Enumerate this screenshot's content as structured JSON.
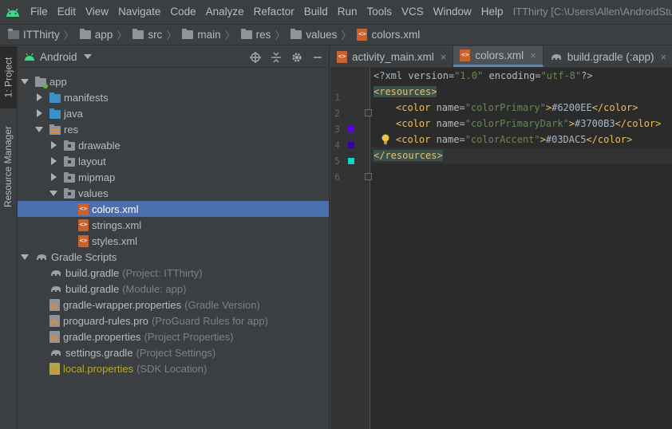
{
  "menubar": {
    "items": [
      "File",
      "Edit",
      "View",
      "Navigate",
      "Code",
      "Analyze",
      "Refactor",
      "Build",
      "Run",
      "Tools",
      "VCS",
      "Window",
      "Help"
    ],
    "title": "ITThirty [C:\\Users\\Allen\\AndroidStudioP"
  },
  "breadcrumb": [
    "ITThirty",
    "app",
    "src",
    "main",
    "res",
    "values",
    "colors.xml"
  ],
  "left_strip": {
    "project_tab": "1: Project",
    "resource_tab": "Resource Manager"
  },
  "project_panel": {
    "view_label": "Android",
    "tree": [
      {
        "label": "app",
        "hint": ""
      },
      {
        "label": "manifests",
        "hint": ""
      },
      {
        "label": "java",
        "hint": ""
      },
      {
        "label": "res",
        "hint": ""
      },
      {
        "label": "drawable",
        "hint": ""
      },
      {
        "label": "layout",
        "hint": ""
      },
      {
        "label": "mipmap",
        "hint": ""
      },
      {
        "label": "values",
        "hint": ""
      },
      {
        "label": "colors.xml",
        "hint": ""
      },
      {
        "label": "strings.xml",
        "hint": ""
      },
      {
        "label": "styles.xml",
        "hint": ""
      },
      {
        "label": "Gradle Scripts",
        "hint": ""
      },
      {
        "label": "build.gradle",
        "hint": "(Project: ITThirty)"
      },
      {
        "label": "build.gradle",
        "hint": "(Module: app)"
      },
      {
        "label": "gradle-wrapper.properties",
        "hint": "(Gradle Version)"
      },
      {
        "label": "proguard-rules.pro",
        "hint": "(ProGuard Rules for app)"
      },
      {
        "label": "gradle.properties",
        "hint": "(Project Properties)"
      },
      {
        "label": "settings.gradle",
        "hint": "(Project Settings)"
      },
      {
        "label": "local.properties",
        "hint": "(SDK Location)"
      }
    ]
  },
  "editor": {
    "tabs": [
      {
        "label": "activity_main.xml",
        "close": "×"
      },
      {
        "label": "colors.xml",
        "close": "×"
      },
      {
        "label": "build.gradle (:app)",
        "close": "×"
      }
    ],
    "line_numbers": [
      "1",
      "2",
      "3",
      "4",
      "5",
      "6"
    ],
    "code": {
      "l1_open": "<?xml ",
      "l1_a1": "version",
      "l1_eq1": "=",
      "l1_v1": "\"1.0\"",
      "l1_a2": " encoding",
      "l1_eq2": "=",
      "l1_v2": "\"utf-8\"",
      "l1_close": "?>",
      "l2": "<resources>",
      "color_open": "<color ",
      "attr_name": "name",
      "eq": "=",
      "color_close_tag": "</color>",
      "l3_name": "\"colorPrimary\"",
      "l3_value": "#6200EE",
      "l4_name": "\"colorPrimaryDark\"",
      "l4_value": "#3700B3",
      "l5_name": "\"colorAccent\"",
      "l5_value": "#03DAC5",
      "l6": "</resources>",
      "gt": ">"
    },
    "swatch_colors": [
      "#6200EE",
      "#3700B3",
      "#03DAC5"
    ]
  }
}
